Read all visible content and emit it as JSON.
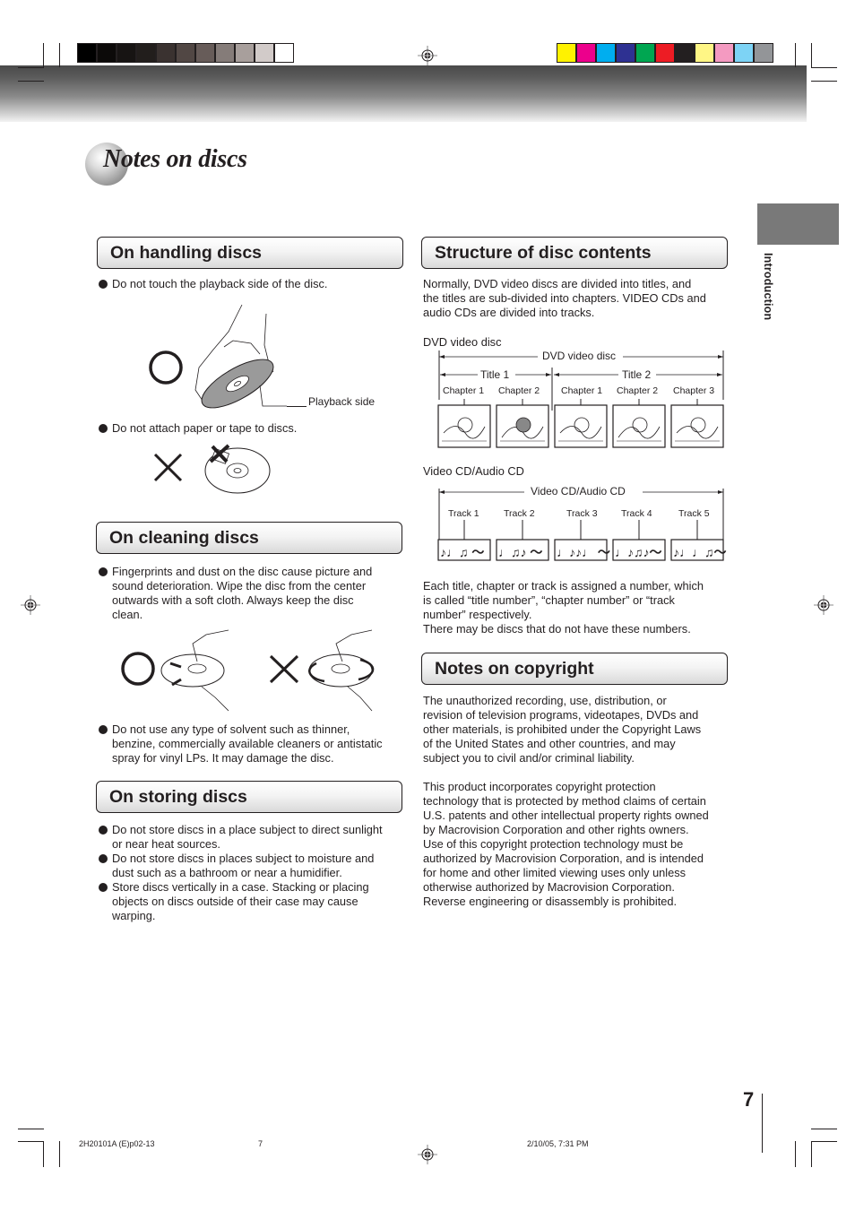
{
  "print_marks": {
    "gray_swatches": [
      "#000000",
      "#0c0a09",
      "#171413",
      "#221e1c",
      "#3a3230",
      "#514744",
      "#675c59",
      "#857c79",
      "#a89f9c",
      "#d2cbc9",
      "#ffffff"
    ],
    "color_swatches": [
      "#fff200",
      "#ec008c",
      "#00aeef",
      "#2e3192",
      "#00a651",
      "#ed1c24",
      "#231f20",
      "#fff685",
      "#f49ac1",
      "#7dd3f5",
      "#939598"
    ]
  },
  "header": {
    "title": "Notes on discs"
  },
  "side_tab": {
    "label": "Introduction"
  },
  "handling": {
    "heading": "On handling discs",
    "bullet1": "Do not touch the playback side of the disc.",
    "playback_label": "Playback side",
    "bullet2": "Do not attach paper or tape to discs."
  },
  "cleaning": {
    "heading": "On cleaning discs",
    "bullet1_lines": [
      "Fingerprints and dust on the disc cause picture and",
      "sound deterioration. Wipe the disc from the center",
      "outwards with a soft cloth. Always keep the disc",
      "clean."
    ],
    "bullet2_lines": [
      "Do not use any type of solvent such as thinner,",
      "benzine, commercially available cleaners or antistatic",
      "spray for vinyl LPs. It may damage the disc."
    ]
  },
  "storing": {
    "heading": "On storing discs",
    "bullets": [
      [
        "Do not store discs in a place subject to direct sunlight",
        "or near heat sources."
      ],
      [
        "Do not store discs in places subject to moisture and",
        "dust such as a bathroom or near a humidifier."
      ],
      [
        "Store discs vertically in a case. Stacking or placing",
        "objects on discs outside of their case may cause",
        "warping."
      ]
    ]
  },
  "structure": {
    "heading": "Structure of disc contents",
    "intro_lines": [
      "Normally, DVD video discs are divided into titles, and",
      "the titles are sub-divided into chapters. VIDEO CDs and",
      "audio CDs are divided into tracks."
    ],
    "dvd_caption": "DVD video disc",
    "dvd_diagram": {
      "disc_label": "DVD video disc",
      "titles": [
        "Title 1",
        "Title 2"
      ],
      "chapters": [
        "Chapter 1",
        "Chapter 2",
        "Chapter 1",
        "Chapter 2",
        "Chapter 3"
      ],
      "thumbnails": [
        "flowers-icon",
        "cat-icon",
        "sailing-ship-icon",
        "airplane-icon",
        "car-icon"
      ]
    },
    "cd_caption": "Video CD/Audio CD",
    "cd_diagram": {
      "disc_label": "Video CD/Audio CD",
      "tracks": [
        "Track 1",
        "Track 2",
        "Track 3",
        "Track 4",
        "Track 5"
      ],
      "notes": [
        "♪♩♫ ～",
        "♩♫♪ ～",
        "♩♪♪♩ ～",
        "♩♪♫♪～",
        "♪♩♩♫～"
      ]
    },
    "numbers_lines": [
      "Each title, chapter or track is assigned a number, which",
      "is called “title number”, “chapter number” or “track",
      "number” respectively.",
      "There may be discs that do not have these numbers."
    ]
  },
  "copyright": {
    "heading": "Notes on copyright",
    "para1_lines": [
      "The unauthorized recording, use, distribution, or",
      "revision of television programs, videotapes, DVDs and",
      "other materials, is prohibited under the Copyright Laws",
      "of the United States and other countries, and may",
      "subject you to civil and/or criminal liability."
    ],
    "para2_lines": [
      "This product incorporates copyright protection",
      "technology that is protected by method claims of certain",
      "U.S. patents and other intellectual property rights owned",
      "by Macrovision Corporation and other rights owners.",
      "Use of this copyright protection technology must be",
      "authorized by Macrovision Corporation, and is intended",
      "for home and other limited viewing uses only unless",
      "otherwise authorized by Macrovision Corporation.",
      "Reverse engineering or disassembly is prohibited."
    ]
  },
  "footer": {
    "page_number": "7",
    "job_code": "2H20101A (E)p02-13",
    "sheet": "7",
    "timestamp": "2/10/05, 7:31 PM"
  }
}
